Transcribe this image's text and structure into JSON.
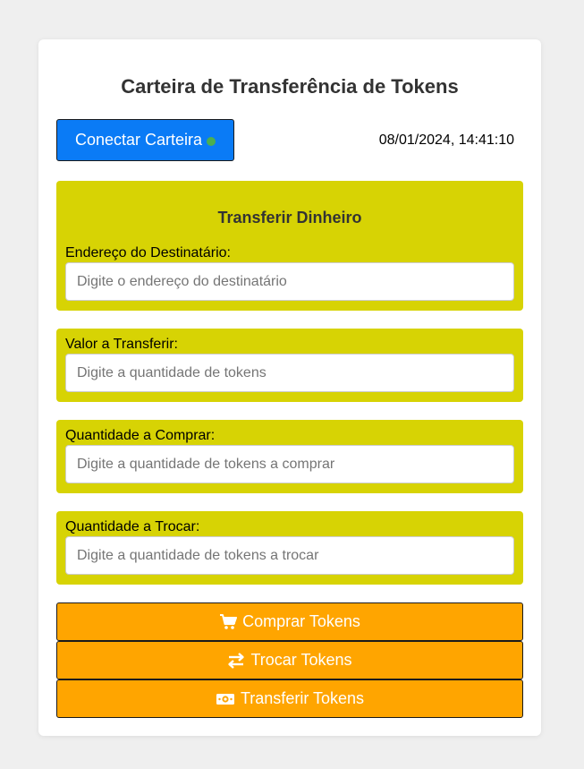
{
  "page": {
    "title": "Carteira de Transferência de Tokens"
  },
  "wallet": {
    "connect_label": "Conectar Carteira",
    "status_icon": "green-status-dot",
    "status_color": "#4caf50",
    "datetime": "08/01/2024, 14:41:10"
  },
  "transfer_panel": {
    "heading": "Transferir Dinheiro",
    "recipient_label": "Endereço do Destinatário:",
    "recipient_placeholder": "Digite o endereço do destinatário",
    "recipient_value": ""
  },
  "amount_panel": {
    "label": "Valor a Transferir:",
    "placeholder": "Digite a quantidade de tokens",
    "value": ""
  },
  "buy_panel": {
    "label": "Quantidade a Comprar:",
    "placeholder": "Digite a quantidade de tokens a comprar",
    "value": ""
  },
  "swap_panel": {
    "label": "Quantidade a Trocar:",
    "placeholder": "Digite a quantidade de tokens a trocar",
    "value": ""
  },
  "actions": {
    "buy_label": "Comprar Tokens",
    "buy_icon": "cart-icon",
    "swap_label": "Trocar Tokens",
    "swap_icon": "exchange-arrows-icon",
    "transfer_label": "Transferir Tokens",
    "transfer_icon": "money-bill-icon"
  },
  "colors": {
    "connect_button": "#0a7bf6",
    "panel_background": "#d7d304",
    "action_button": "#ffa500",
    "page_background": "#efefef"
  }
}
